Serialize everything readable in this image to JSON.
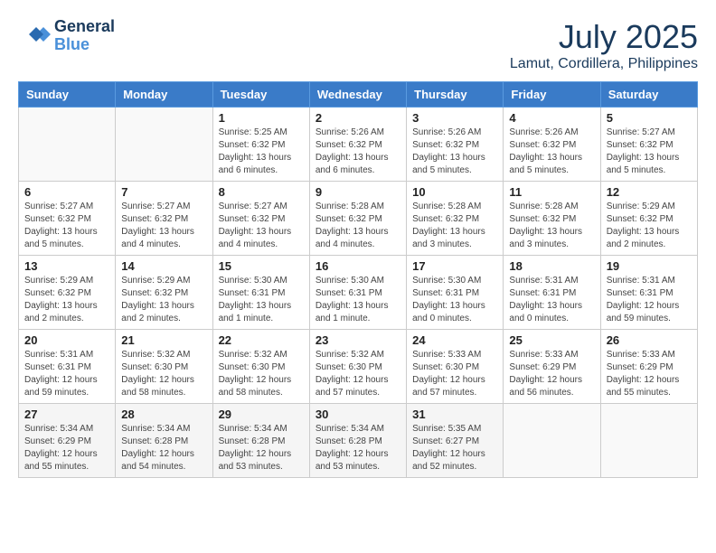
{
  "header": {
    "logo_line1": "General",
    "logo_line2": "Blue",
    "month": "July 2025",
    "location": "Lamut, Cordillera, Philippines"
  },
  "weekdays": [
    "Sunday",
    "Monday",
    "Tuesday",
    "Wednesday",
    "Thursday",
    "Friday",
    "Saturday"
  ],
  "weeks": [
    [
      {
        "day": "",
        "info": ""
      },
      {
        "day": "",
        "info": ""
      },
      {
        "day": "1",
        "info": "Sunrise: 5:25 AM\nSunset: 6:32 PM\nDaylight: 13 hours and 6 minutes."
      },
      {
        "day": "2",
        "info": "Sunrise: 5:26 AM\nSunset: 6:32 PM\nDaylight: 13 hours and 6 minutes."
      },
      {
        "day": "3",
        "info": "Sunrise: 5:26 AM\nSunset: 6:32 PM\nDaylight: 13 hours and 5 minutes."
      },
      {
        "day": "4",
        "info": "Sunrise: 5:26 AM\nSunset: 6:32 PM\nDaylight: 13 hours and 5 minutes."
      },
      {
        "day": "5",
        "info": "Sunrise: 5:27 AM\nSunset: 6:32 PM\nDaylight: 13 hours and 5 minutes."
      }
    ],
    [
      {
        "day": "6",
        "info": "Sunrise: 5:27 AM\nSunset: 6:32 PM\nDaylight: 13 hours and 5 minutes."
      },
      {
        "day": "7",
        "info": "Sunrise: 5:27 AM\nSunset: 6:32 PM\nDaylight: 13 hours and 4 minutes."
      },
      {
        "day": "8",
        "info": "Sunrise: 5:27 AM\nSunset: 6:32 PM\nDaylight: 13 hours and 4 minutes."
      },
      {
        "day": "9",
        "info": "Sunrise: 5:28 AM\nSunset: 6:32 PM\nDaylight: 13 hours and 4 minutes."
      },
      {
        "day": "10",
        "info": "Sunrise: 5:28 AM\nSunset: 6:32 PM\nDaylight: 13 hours and 3 minutes."
      },
      {
        "day": "11",
        "info": "Sunrise: 5:28 AM\nSunset: 6:32 PM\nDaylight: 13 hours and 3 minutes."
      },
      {
        "day": "12",
        "info": "Sunrise: 5:29 AM\nSunset: 6:32 PM\nDaylight: 13 hours and 2 minutes."
      }
    ],
    [
      {
        "day": "13",
        "info": "Sunrise: 5:29 AM\nSunset: 6:32 PM\nDaylight: 13 hours and 2 minutes."
      },
      {
        "day": "14",
        "info": "Sunrise: 5:29 AM\nSunset: 6:32 PM\nDaylight: 13 hours and 2 minutes."
      },
      {
        "day": "15",
        "info": "Sunrise: 5:30 AM\nSunset: 6:31 PM\nDaylight: 13 hours and 1 minute."
      },
      {
        "day": "16",
        "info": "Sunrise: 5:30 AM\nSunset: 6:31 PM\nDaylight: 13 hours and 1 minute."
      },
      {
        "day": "17",
        "info": "Sunrise: 5:30 AM\nSunset: 6:31 PM\nDaylight: 13 hours and 0 minutes."
      },
      {
        "day": "18",
        "info": "Sunrise: 5:31 AM\nSunset: 6:31 PM\nDaylight: 13 hours and 0 minutes."
      },
      {
        "day": "19",
        "info": "Sunrise: 5:31 AM\nSunset: 6:31 PM\nDaylight: 12 hours and 59 minutes."
      }
    ],
    [
      {
        "day": "20",
        "info": "Sunrise: 5:31 AM\nSunset: 6:31 PM\nDaylight: 12 hours and 59 minutes."
      },
      {
        "day": "21",
        "info": "Sunrise: 5:32 AM\nSunset: 6:30 PM\nDaylight: 12 hours and 58 minutes."
      },
      {
        "day": "22",
        "info": "Sunrise: 5:32 AM\nSunset: 6:30 PM\nDaylight: 12 hours and 58 minutes."
      },
      {
        "day": "23",
        "info": "Sunrise: 5:32 AM\nSunset: 6:30 PM\nDaylight: 12 hours and 57 minutes."
      },
      {
        "day": "24",
        "info": "Sunrise: 5:33 AM\nSunset: 6:30 PM\nDaylight: 12 hours and 57 minutes."
      },
      {
        "day": "25",
        "info": "Sunrise: 5:33 AM\nSunset: 6:29 PM\nDaylight: 12 hours and 56 minutes."
      },
      {
        "day": "26",
        "info": "Sunrise: 5:33 AM\nSunset: 6:29 PM\nDaylight: 12 hours and 55 minutes."
      }
    ],
    [
      {
        "day": "27",
        "info": "Sunrise: 5:34 AM\nSunset: 6:29 PM\nDaylight: 12 hours and 55 minutes."
      },
      {
        "day": "28",
        "info": "Sunrise: 5:34 AM\nSunset: 6:28 PM\nDaylight: 12 hours and 54 minutes."
      },
      {
        "day": "29",
        "info": "Sunrise: 5:34 AM\nSunset: 6:28 PM\nDaylight: 12 hours and 53 minutes."
      },
      {
        "day": "30",
        "info": "Sunrise: 5:34 AM\nSunset: 6:28 PM\nDaylight: 12 hours and 53 minutes."
      },
      {
        "day": "31",
        "info": "Sunrise: 5:35 AM\nSunset: 6:27 PM\nDaylight: 12 hours and 52 minutes."
      },
      {
        "day": "",
        "info": ""
      },
      {
        "day": "",
        "info": ""
      }
    ]
  ]
}
